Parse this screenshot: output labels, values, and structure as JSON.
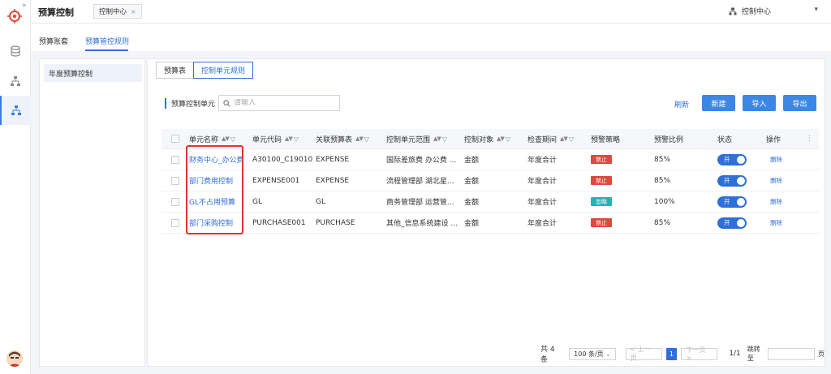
{
  "app": {
    "title": "预算控制"
  },
  "top_tab": {
    "label": "控制中心",
    "close": "×"
  },
  "top_right": {
    "org_label": "控制中心",
    "dropdown": "▾"
  },
  "subtabs": [
    {
      "label": "预算账套"
    },
    {
      "label": "预算管控规则"
    }
  ],
  "tree": {
    "items": [
      {
        "label": "年度预算控制"
      }
    ]
  },
  "main_tabs": [
    {
      "label": "预算表"
    },
    {
      "label": "控制单元规则"
    }
  ],
  "filter": {
    "label": "预算控制单元",
    "placeholder": "请输入"
  },
  "actions": {
    "refresh": "刷新",
    "new": "新建",
    "import": "导入",
    "export": "导出"
  },
  "table": {
    "columns": [
      "单元名称",
      "单元代码",
      "关联预算表",
      "控制单元范围",
      "控制对象",
      "检查期间",
      "预警策略",
      "预警比例",
      "状态",
      "操作"
    ],
    "more": "⋮",
    "rows": [
      {
        "name": "财务中心_办公费",
        "code": "A30100_C19010",
        "table": "EXPENSE",
        "scope": "国际差旅费 办公费 ...",
        "object": "金额",
        "period": "年度合计",
        "strategy": "禁止",
        "strategy_color": "#e0473e",
        "ratio": "85%",
        "status": "开",
        "op": "删除"
      },
      {
        "name": "部门费用控制",
        "code": "EXPENSE001",
        "table": "EXPENSE",
        "scope": "流程管理部 湖北星...",
        "object": "金额",
        "period": "年度合计",
        "strategy": "禁止",
        "strategy_color": "#e0473e",
        "ratio": "85%",
        "status": "开",
        "op": "删除"
      },
      {
        "name": "GL不占用预算",
        "code": "GL",
        "table": "GL",
        "scope": "商务管理部 运营管...",
        "object": "金额",
        "period": "年度合计",
        "strategy": "忽略",
        "strategy_color": "#27b1b6",
        "ratio": "100%",
        "status": "开",
        "op": "删除"
      },
      {
        "name": "部门采购控制",
        "code": "PURCHASE001",
        "table": "PURCHASE",
        "scope": "其他_信息系统建设 ...",
        "object": "金额",
        "period": "年度合计",
        "strategy": "禁止",
        "strategy_color": "#e0473e",
        "ratio": "85%",
        "status": "开",
        "op": "删除"
      }
    ]
  },
  "pagination": {
    "total": "共 4 条",
    "page_size": "100 条/页",
    "prev": "< 上一页",
    "current": "1",
    "next": "下一页 >",
    "page_count": "1/1",
    "jump_label": "跳转至",
    "page_unit": "页"
  }
}
